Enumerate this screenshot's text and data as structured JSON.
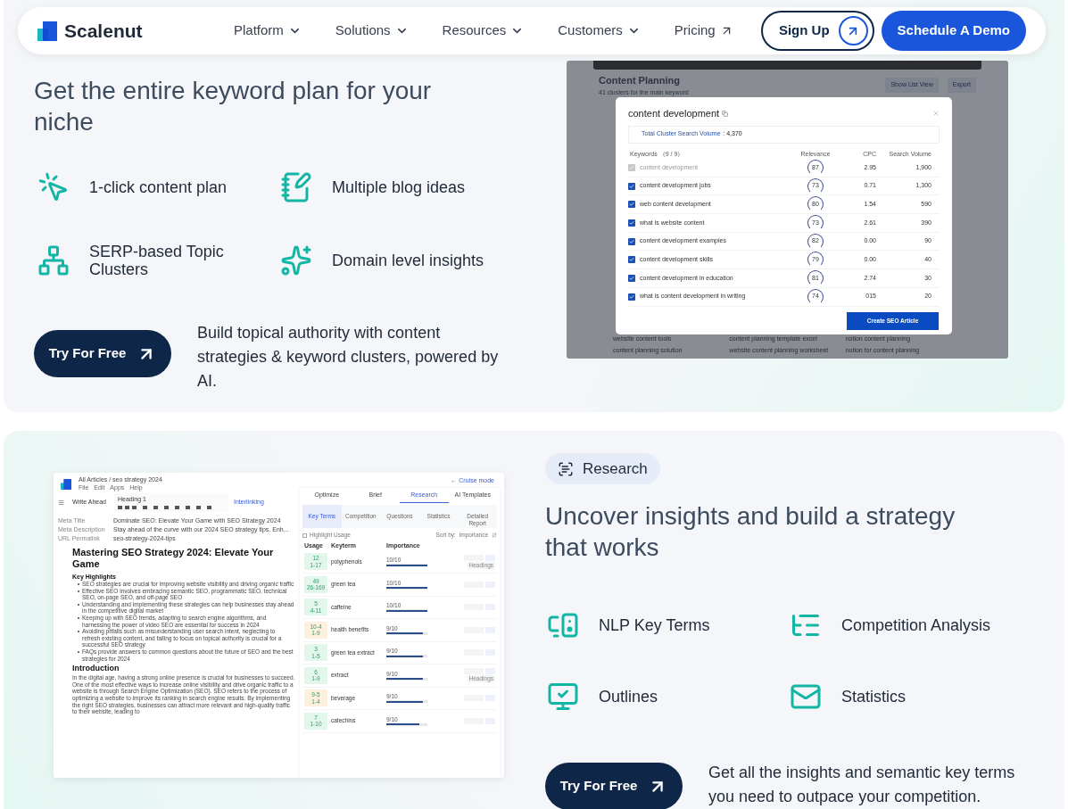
{
  "nav": {
    "logo": "Scalenut",
    "items": [
      {
        "label": "Platform",
        "kind": "menu"
      },
      {
        "label": "Solutions",
        "kind": "menu"
      },
      {
        "label": "Resources",
        "kind": "menu"
      },
      {
        "label": "Customers",
        "kind": "menu"
      },
      {
        "label": "Pricing",
        "kind": "link"
      }
    ],
    "sign_up": "Sign Up",
    "demo": "Schedule A Demo"
  },
  "keyword_plan": {
    "heading": "Get the entire keyword plan for your niche",
    "features": [
      {
        "label": "1-click content plan",
        "kind": "click"
      },
      {
        "label": "Multiple blog ideas",
        "kind": "notes"
      },
      {
        "label": "SERP-based Topic Clusters",
        "kind": "cluster"
      },
      {
        "label": "Domain level insights",
        "kind": "star"
      }
    ],
    "cta": "Try For Free",
    "description": "Build topical authority with content strategies & keyword clusters, powered by AI.",
    "screenshot": {
      "title": "Content Planning",
      "subtitle": "41 clusters for the main keyword",
      "buttons": [
        "Show List View",
        "Export"
      ],
      "background_keywords": [
        "website content tools",
        "content planning template excel",
        "notion content planning",
        "content planning solution",
        "website content planning worksheet",
        "notion for content planning"
      ],
      "modal": {
        "title": "content development",
        "volume_label": "Total Cluster Search Volume",
        "volume": ": 4,370",
        "columns": [
          "Keywords （9 / 9）",
          "Relevance",
          "CPC",
          "Search Volume"
        ],
        "rows": [
          {
            "keyword": "content development",
            "checked": true,
            "disabled": true,
            "relevance": "87",
            "cpc": "2.95",
            "volume": "1,900"
          },
          {
            "keyword": "content development jobs",
            "checked": true,
            "disabled": false,
            "relevance": "73",
            "cpc": "0.71",
            "volume": "1,300"
          },
          {
            "keyword": "web content development",
            "checked": true,
            "disabled": false,
            "relevance": "80",
            "cpc": "1.54",
            "volume": "590"
          },
          {
            "keyword": "what is website content",
            "checked": true,
            "disabled": false,
            "relevance": "73",
            "cpc": "2.61",
            "volume": "390"
          },
          {
            "keyword": "content development examples",
            "checked": true,
            "disabled": false,
            "relevance": "82",
            "cpc": "0.00",
            "volume": "90"
          },
          {
            "keyword": "content development skills",
            "checked": true,
            "disabled": false,
            "relevance": "79",
            "cpc": "0.00",
            "volume": "40"
          },
          {
            "keyword": "content development in education",
            "checked": true,
            "disabled": false,
            "relevance": "81",
            "cpc": "2.74",
            "volume": "30"
          },
          {
            "keyword": "what is content development in writing",
            "checked": true,
            "disabled": false,
            "relevance": "74",
            "cpc": "015",
            "volume": "20"
          }
        ],
        "button": "Create SEO Article"
      }
    }
  },
  "research": {
    "tag": "Research",
    "heading": "Uncover insights and build a strategy that works",
    "features": [
      {
        "label": "NLP Key Terms",
        "kind": "monitor"
      },
      {
        "label": "Competition Analysis",
        "kind": "list"
      },
      {
        "label": "Outlines",
        "kind": "outline"
      },
      {
        "label": "Statistics",
        "kind": "mail"
      }
    ],
    "cta": "Try For Free",
    "description": "Get all the insights and semantic key terms you need to outpace your competition.",
    "editor": {
      "breadcrumb": "All Articles / seo strategy 2024",
      "menu": [
        "File",
        "Edit",
        "Apps",
        "Help"
      ],
      "heading_select": "Heading 1",
      "write_ahead": "Write Ahead",
      "interlinking": "Interlinking",
      "meta": [
        {
          "label": "Meta Title",
          "value": "Dominate SEO: Elevate Your Game with SEO Strategy 2024"
        },
        {
          "label": "Meta Description",
          "value": "Stay ahead of the curve with our 2024 SEO strategy tips. Enh..."
        },
        {
          "label": "URL Permalink",
          "value": "seo-strategy-2024-tips"
        }
      ],
      "title": "Mastering SEO Strategy 2024: Elevate Your Game",
      "subheading": "Key Highlights",
      "bullets": [
        "SEO strategies are crucial for improving website visibility and driving organic traffic",
        "Effective SEO involves embracing semantic SEO, programmatic SEO, technical SEO, on-page SEO, and off-page SEO",
        "Understanding and implementing these strategies can help businesses stay ahead in the competitive digital market",
        "Keeping up with SEO trends, adapting to search engine algorithms, and harnessing the power of video SEO are essential for success in 2024",
        "Avoiding pitfalls such as misunderstanding user search intent, neglecting to refresh existing content, and failing to focus on topical authority is crucial for a successful SEO strategy",
        "FAQs provide answers to common questions about the future of SEO and the best strategies for 2024"
      ],
      "section_title": "Introduction",
      "paragraph": "In the digital age, having a strong online presence is crucial for businesses to succeed. One of the most effective ways to increase online visibility and drive organic traffic to a website is through Search Engine Optimization (SEO). SEO refers to the process of optimizing a website to improve its ranking in search engine results. By implementing the right SEO strategies, businesses can attract more relevant and high-quality traffic to their website, leading to"
    },
    "panel": {
      "cruise": "← Cruise mode",
      "tabs": [
        {
          "label": "Optimize",
          "selected": false
        },
        {
          "label": "Brief",
          "selected": false
        },
        {
          "label": "Research",
          "selected": true
        },
        {
          "label": "AI Templates",
          "selected": false
        }
      ],
      "subtabs": [
        {
          "label": "Key Terms",
          "selected": true
        },
        {
          "label": "Competition",
          "selected": false
        },
        {
          "label": "Questions",
          "selected": false
        },
        {
          "label": "Statistics",
          "selected": false
        },
        {
          "label": "Detailed Report",
          "selected": false
        }
      ],
      "highlight": {
        "label": "Highlight Usage",
        "checked": false
      },
      "sort": "Sort by:  Importance",
      "columns": [
        "Usage",
        "Keyterm",
        "Importance"
      ],
      "rows": [
        {
          "count": "12",
          "range": "1-17",
          "color": "#e3f6ec",
          "term": "polyphenols",
          "score": "10/10",
          "level": 1,
          "headings": "Headings"
        },
        {
          "count": "49",
          "range": "26-169",
          "color": "#e3f6ec",
          "term": "green tea",
          "score": "10/10",
          "level": 1
        },
        {
          "count": "5",
          "range": "4-11",
          "color": "#e3f6ec",
          "term": "caffeine",
          "score": "10/10",
          "level": 1
        },
        {
          "count": "10-4",
          "range": "1-9",
          "color": "#fdf0dc",
          "term": "health benefits",
          "score": "9/10",
          "level": 0.9
        },
        {
          "count": "3",
          "range": "1-5",
          "color": "#e3f6ec",
          "term": "green tea extract",
          "score": "9/10",
          "level": 0.9
        },
        {
          "count": "6",
          "range": "1-9",
          "color": "#e3f6ec",
          "term": "extract",
          "score": "9/10",
          "level": 0.9,
          "headings": "Headings"
        },
        {
          "count": "9-5",
          "range": "1-4",
          "color": "#fdf0dc",
          "term": "beverage",
          "score": "9/10",
          "level": 0.9
        },
        {
          "count": "7",
          "range": "1-10",
          "color": "#e3f6ec",
          "term": "catechins",
          "score": "9/10",
          "level": 0.8
        }
      ]
    }
  }
}
